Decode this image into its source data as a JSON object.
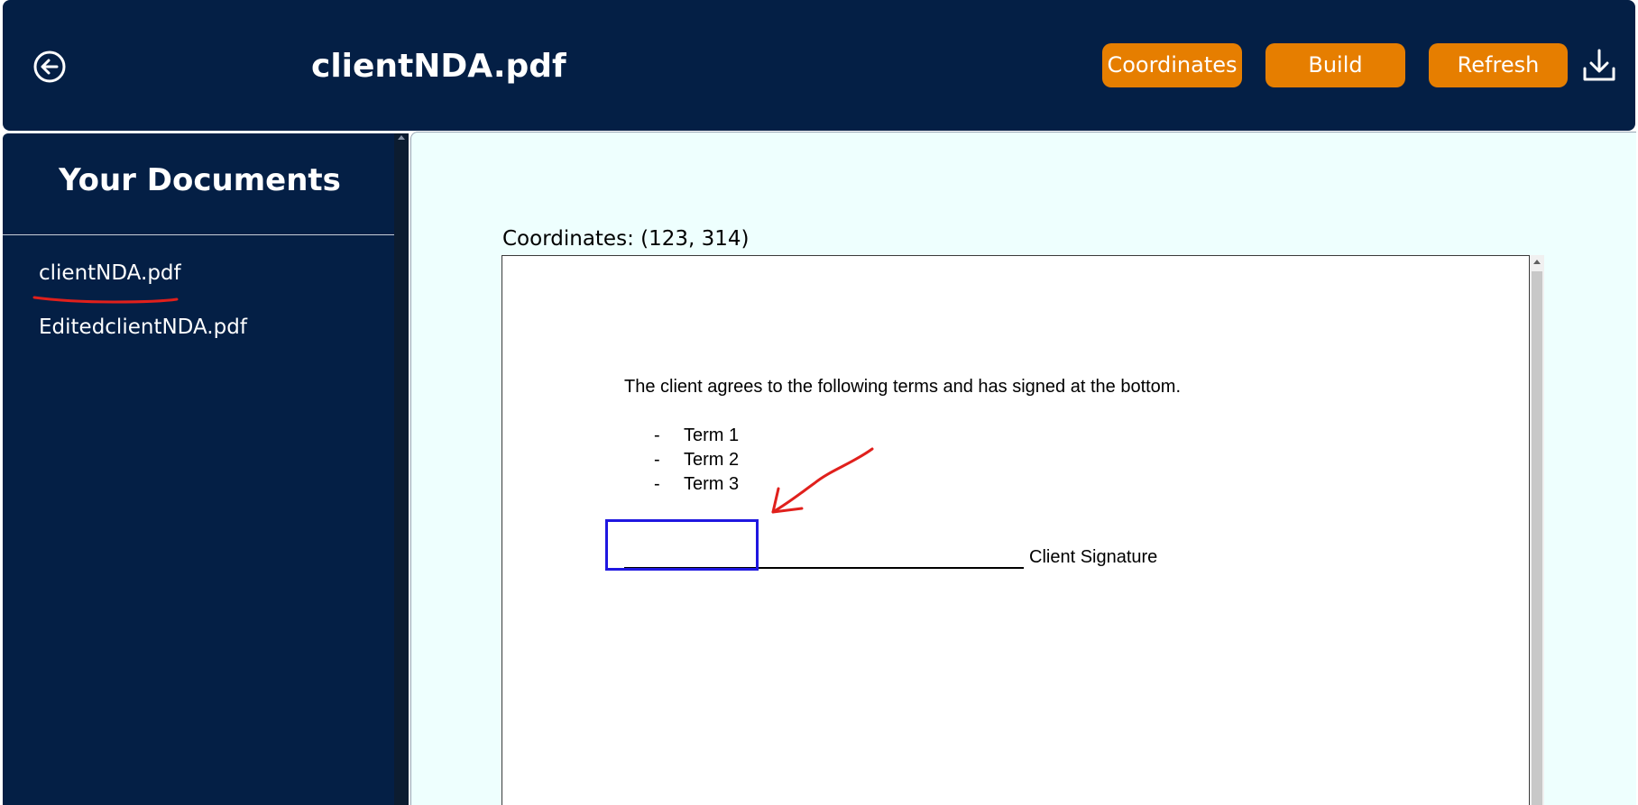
{
  "header": {
    "title": "clientNDA.pdf",
    "buttons": {
      "coordinates": "Coordinates",
      "build": "Build",
      "refresh": "Refresh"
    },
    "icons": {
      "back": "back-arrow-circle-icon",
      "download": "download-icon"
    }
  },
  "sidebar": {
    "heading": "Your Documents",
    "items": [
      {
        "label": "clientNDA.pdf",
        "selected": true
      },
      {
        "label": "EditedclientNDA.pdf",
        "selected": false
      }
    ]
  },
  "viewer": {
    "coordinates_label": "Coordinates: (123, 314)",
    "document": {
      "intro": "The client agrees to the following terms and has signed at the bottom.",
      "terms": [
        {
          "bullet": "-",
          "text": "Term 1"
        },
        {
          "bullet": "-",
          "text": "Term 2"
        },
        {
          "bullet": "-",
          "text": "Term 3"
        }
      ],
      "signature_label": "Client Signature"
    }
  },
  "colors": {
    "header_bg": "#041f45",
    "sidebar_bg": "#041f45",
    "button_bg": "#e67e00",
    "main_bg": "#eefffe",
    "selection_box": "#1f17e0",
    "annotation": "#e0201c"
  }
}
